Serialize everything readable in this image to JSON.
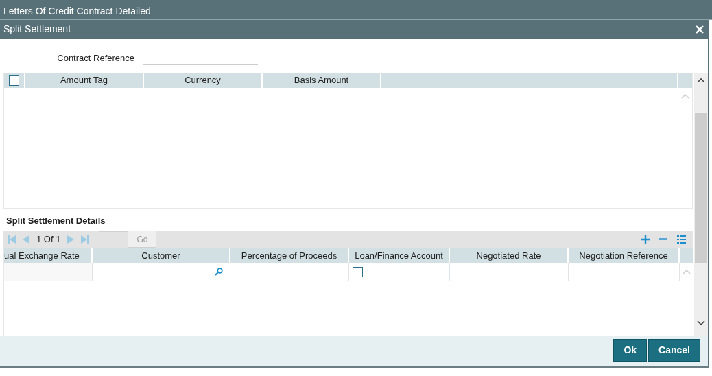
{
  "app_title": "Letters Of Credit Contract Detailed",
  "dialog": {
    "title": "Split Settlement",
    "contract_reference": {
      "label": "Contract Reference"
    },
    "amount_grid": {
      "select_all_checked": false,
      "columns": [
        "Amount Tag",
        "Currency",
        "Basis Amount"
      ]
    },
    "details": {
      "title": "Split Settlement Details",
      "pager": {
        "page": "1 Of 1",
        "go": "Go"
      },
      "columns": [
        "ual Exchange Rate",
        "Customer",
        "Percentage of Proceeds",
        "Loan/Finance Account",
        "Negotiated Rate",
        "Negotiation Reference"
      ],
      "rows": [
        {
          "loan_finance_account_checked": false
        }
      ]
    },
    "buttons": [
      "Ok",
      "Cancel"
    ]
  }
}
